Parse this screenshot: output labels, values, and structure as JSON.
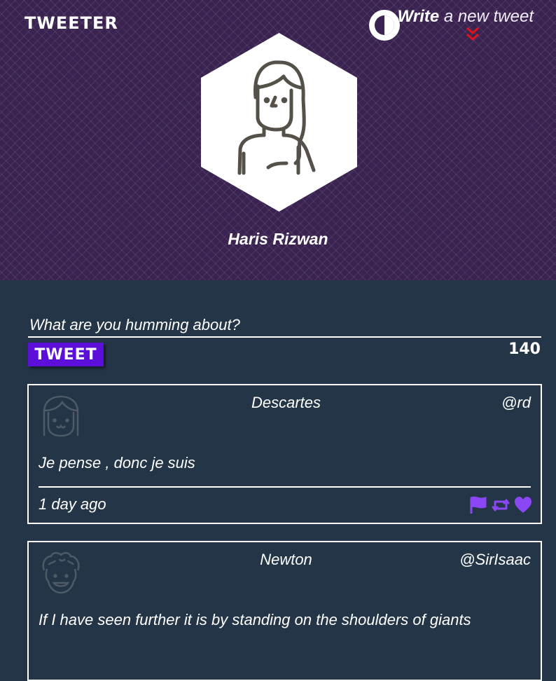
{
  "header": {
    "brand": "Tweeter",
    "compose_bold": "Write",
    "compose_rest": " a new tweet",
    "username": "Haris Rizwan"
  },
  "composer": {
    "placeholder": "What are you humming about?",
    "button_label": "Tweet",
    "counter": "140"
  },
  "tweets": [
    {
      "name": "Descartes",
      "handle": "@rd",
      "content": "Je pense , donc je suis",
      "time": "1 day ago"
    },
    {
      "name": "Newton",
      "handle": "@SirIsaac",
      "content": "If I have seen further it is by standing on the shoulders of giants",
      "time": ""
    }
  ],
  "colors": {
    "hero_bg": "#3a2350",
    "body_bg": "#233547",
    "accent": "#5b0fd8",
    "icon_purple": "#8b47f4",
    "arrow_red": "#e0141c"
  },
  "icons": {
    "theme": "half-circle-contrast-icon",
    "compose_arrow": "double-chevron-down-icon",
    "flag": "flag-icon",
    "retweet": "retweet-icon",
    "like": "heart-icon"
  }
}
